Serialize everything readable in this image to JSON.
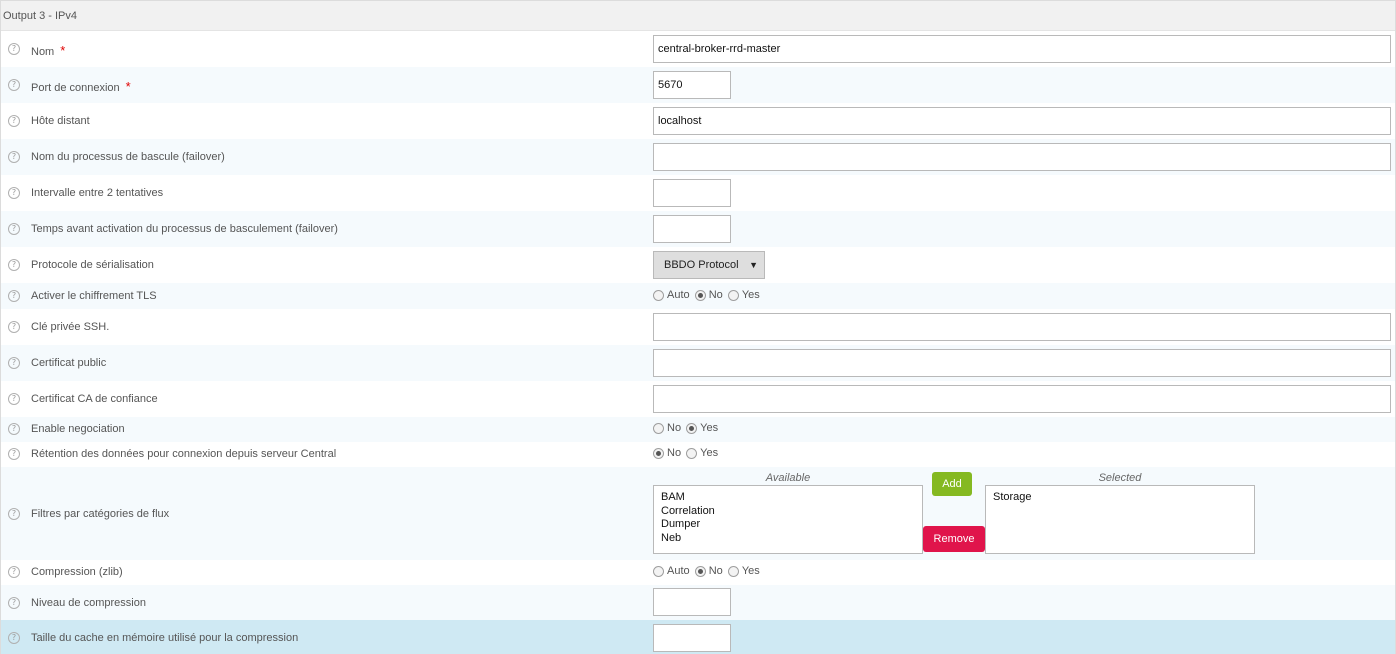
{
  "section": {
    "title": "Output 3 - IPv4"
  },
  "help_glyph": "?",
  "required_mark": "*",
  "fields": {
    "name": {
      "label": "Nom",
      "value": "central-broker-rrd-master"
    },
    "port": {
      "label": "Port de connexion",
      "value": "5670"
    },
    "host": {
      "label": "Hôte distant",
      "value": "localhost"
    },
    "failover_name": {
      "label": "Nom du processus de bascule (failover)",
      "value": ""
    },
    "retry_interval": {
      "label": "Intervalle entre 2 tentatives",
      "value": ""
    },
    "failover_delay": {
      "label": "Temps avant activation du processus de basculement (failover)",
      "value": ""
    },
    "protocol": {
      "label": "Protocole de sérialisation",
      "value": "BBDO Protocol",
      "arrow": "▼"
    },
    "tls": {
      "label": "Activer le chiffrement TLS",
      "options": [
        "Auto",
        "No",
        "Yes"
      ],
      "selected": "No"
    },
    "private_key": {
      "label": "Clé privée SSH.",
      "value": ""
    },
    "public_cert": {
      "label": "Certificat public",
      "value": ""
    },
    "ca_cert": {
      "label": "Certificat CA de confiance",
      "value": ""
    },
    "negotiation": {
      "label": "Enable negociation",
      "options": [
        "No",
        "Yes"
      ],
      "selected": "Yes"
    },
    "retention": {
      "label": "Rétention des données pour connexion depuis serveur Central",
      "options": [
        "No",
        "Yes"
      ],
      "selected": "No"
    },
    "filters": {
      "label": "Filtres par catégories de flux",
      "available_caption": "Available",
      "selected_caption": "Selected",
      "available": [
        "BAM",
        "Correlation",
        "Dumper",
        "Neb"
      ],
      "selected": [
        "Storage"
      ],
      "add_label": "Add",
      "remove_label": "Remove"
    },
    "compression": {
      "label": "Compression (zlib)",
      "options": [
        "Auto",
        "No",
        "Yes"
      ],
      "selected": "No"
    },
    "compression_level": {
      "label": "Niveau de compression",
      "value": ""
    },
    "compression_cache": {
      "label": "Taille du cache en mémoire utilisé pour la compression",
      "value": ""
    }
  },
  "colors": {
    "add_button": "#85b921",
    "remove_button": "#e0144b",
    "required": "#e00000",
    "highlight_row": "#cfe9f3"
  }
}
